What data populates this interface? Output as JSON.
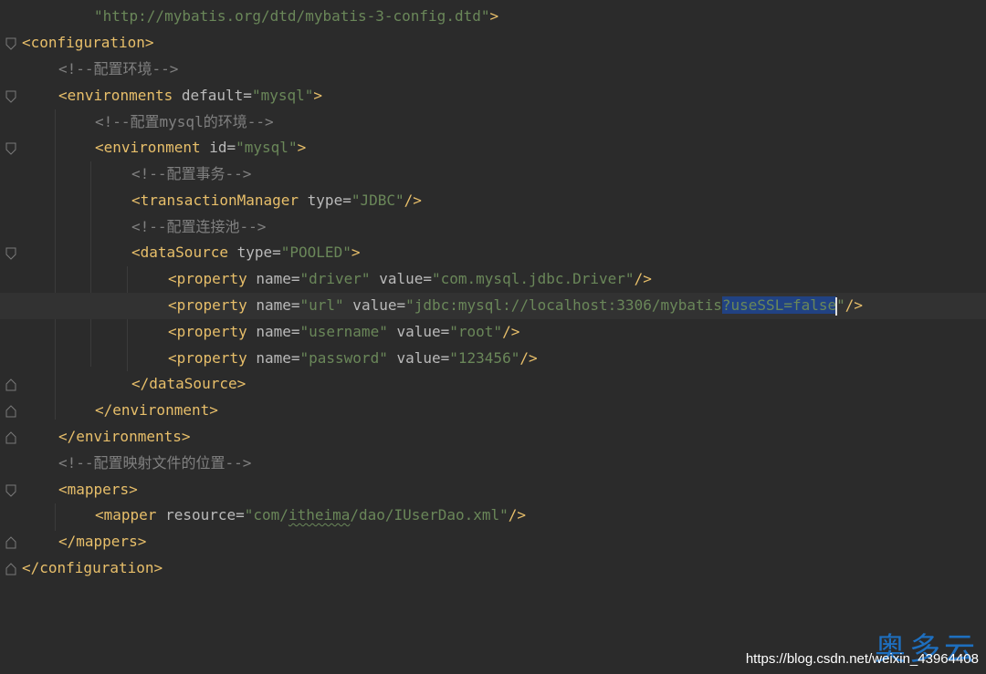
{
  "editor": {
    "language": "XML",
    "colors": {
      "background": "#2b2b2b",
      "tag": "#e8bf6a",
      "attribute": "#bababa",
      "value": "#6a8759",
      "comment": "#808080",
      "selection": "#214283"
    },
    "lines": {
      "l0": {
        "val": "\"http://mybatis.org/dtd/mybatis-3-config.dtd\"",
        "close": ">"
      },
      "l1": {
        "open": "<",
        "tag": "configuration",
        "close": ">"
      },
      "l2": {
        "comment": "<!--配置环境-->"
      },
      "l3": {
        "open": "<",
        "tag": "environments",
        "attr1": " default=",
        "val1": "\"mysql\"",
        "close": ">"
      },
      "l4": {
        "comment": "<!--配置mysql的环境-->"
      },
      "l5": {
        "open": "<",
        "tag": "environment",
        "attr1": " id=",
        "val1": "\"mysql\"",
        "close": ">"
      },
      "l6": {
        "comment": "<!--配置事务-->"
      },
      "l7": {
        "open": "<",
        "tag": "transactionManager",
        "attr1": " type=",
        "val1": "\"JDBC\"",
        "close": "/>"
      },
      "l8": {
        "comment": "<!--配置连接池-->"
      },
      "l9": {
        "open": "<",
        "tag": "dataSource",
        "attr1": " type=",
        "val1": "\"POOLED\"",
        "close": ">"
      },
      "l10": {
        "open": "<",
        "tag": "property",
        "attr1": " name=",
        "val1": "\"driver\"",
        "attr2": " value=",
        "val2": "\"com.mysql.jdbc.Driver\"",
        "close": "/>"
      },
      "l11": {
        "open": "<",
        "tag": "property",
        "attr1": " name=",
        "val1": "\"url\"",
        "attr2": " value=",
        "val2a": "\"jdbc:mysql://localhost:3306/mybatis",
        "val2sel": "?useSSL=false",
        "val2b": "\"",
        "close": "/>"
      },
      "l12": {
        "open": "<",
        "tag": "property",
        "attr1": " name=",
        "val1": "\"username\"",
        "attr2": " value=",
        "val2": "\"root\"",
        "close": "/>"
      },
      "l13": {
        "open": "<",
        "tag": "property",
        "attr1": " name=",
        "val1": "\"password\"",
        "attr2": " value=",
        "val2": "\"123456\"",
        "close": "/>"
      },
      "l14": {
        "open": "</",
        "tag": "dataSource",
        "close": ">"
      },
      "l15": {
        "open": "</",
        "tag": "environment",
        "close": ">"
      },
      "l16": {
        "open": "</",
        "tag": "environments",
        "close": ">"
      },
      "l17": {
        "comment": "<!--配置映射文件的位置-->"
      },
      "l18": {
        "open": "<",
        "tag": "mappers",
        "close": ">"
      },
      "l19": {
        "open": "<",
        "tag": "mapper",
        "attr1": " resource=",
        "val1a": "\"com/",
        "val1sq": "itheima",
        "val1b": "/dao/IUserDao.xml\"",
        "close": "/>"
      },
      "l20": {
        "open": "</",
        "tag": "mappers",
        "close": ">"
      },
      "l21": {
        "open": "</",
        "tag": "configuration",
        "close": ">"
      }
    }
  },
  "watermark": {
    "url": "https://blog.csdn.net/weixin_43964408",
    "logo": "奥多云"
  }
}
